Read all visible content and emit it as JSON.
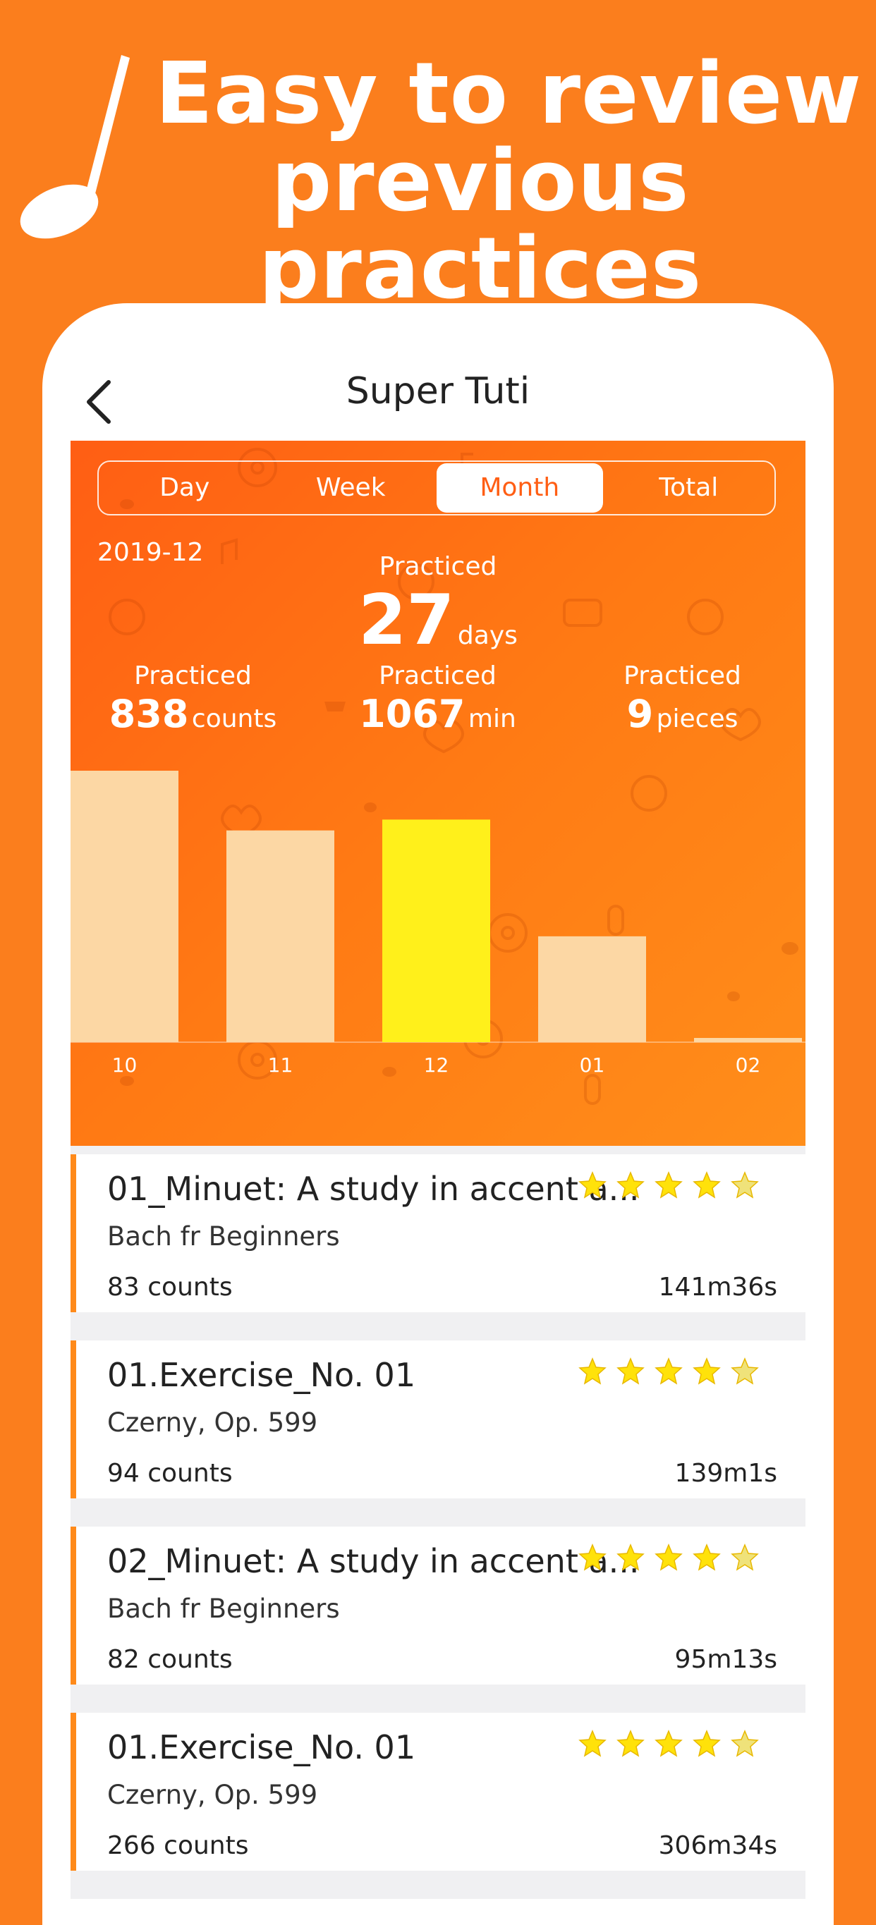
{
  "promo": {
    "headline_line1": "Easy to review",
    "headline_line2": "previous practices"
  },
  "nav": {
    "title": "Super Tuti"
  },
  "tabs": [
    {
      "label": "Day",
      "active": false
    },
    {
      "label": "Week",
      "active": false
    },
    {
      "label": "Month",
      "active": true
    },
    {
      "label": "Total",
      "active": false
    }
  ],
  "summary": {
    "period": "2019-12",
    "practiced_label": "Practiced",
    "days_value": "27",
    "days_unit": "days",
    "counts_value": "838",
    "counts_unit": "counts",
    "minutes_value": "1067",
    "minutes_unit": "min",
    "pieces_value": "9",
    "pieces_unit": "pieces"
  },
  "chart_data": {
    "type": "bar",
    "categories": [
      "10",
      "11",
      "12",
      "01",
      "02"
    ],
    "values": [
      100,
      78,
      82,
      39,
      1
    ],
    "highlight_index": 2,
    "colors": {
      "bar": "#fcd7a4",
      "highlight": "#fff01b"
    }
  },
  "practices": [
    {
      "title": "01_Minuet: A study in accent a...",
      "book": "Bach fr Beginners",
      "counts": "83 counts",
      "duration": "141m36s",
      "stars": 5
    },
    {
      "title": "01.Exercise_No. 01",
      "book": "Czerny, Op. 599",
      "counts": "94 counts",
      "duration": "139m1s",
      "stars": 5
    },
    {
      "title": "02_Minuet: A study in accent a...",
      "book": "Bach fr Beginners",
      "counts": "82 counts",
      "duration": "95m13s",
      "stars": 5
    },
    {
      "title": "01.Exercise_No. 01",
      "book": "Czerny, Op. 599",
      "counts": "266 counts",
      "duration": "306m34s",
      "stars": 5
    }
  ],
  "colors": {
    "accent": "#fb7e1d",
    "panel": "#ff6a14",
    "star": "#ffe20a"
  }
}
